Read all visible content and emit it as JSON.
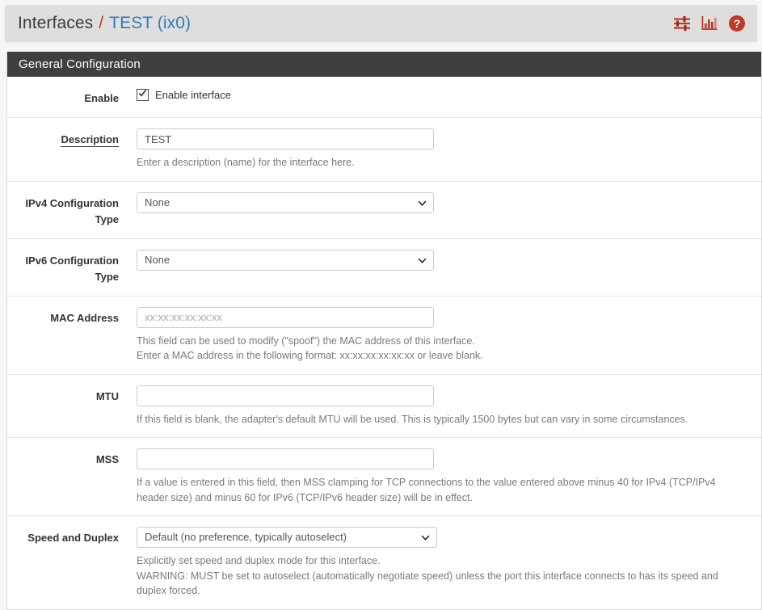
{
  "breadcrumb": {
    "root": "Interfaces",
    "separator": "/",
    "current": "TEST (ix0)"
  },
  "header_icons": [
    {
      "name": "sliders-icon",
      "title": "Advanced"
    },
    {
      "name": "bar-chart-icon",
      "title": "Status"
    },
    {
      "name": "help-icon",
      "title": "Help"
    }
  ],
  "panel": {
    "title": "General Configuration"
  },
  "fields": {
    "enable": {
      "label": "Enable",
      "checkbox_label": "Enable interface",
      "checked": true
    },
    "description": {
      "label": "Description",
      "value": "TEST",
      "help": "Enter a description (name) for the interface here."
    },
    "ipv4_config": {
      "label_line1": "IPv4 Configuration",
      "label_line2": "Type",
      "value": "None"
    },
    "ipv6_config": {
      "label_line1": "IPv6 Configuration",
      "label_line2": "Type",
      "value": "None"
    },
    "mac_address": {
      "label": "MAC Address",
      "value": "",
      "placeholder": "xx:xx:xx:xx:xx:xx",
      "help_line1": "This field can be used to modify (\"spoof\") the MAC address of this interface.",
      "help_line2": "Enter a MAC address in the following format: xx:xx:xx:xx:xx:xx or leave blank."
    },
    "mtu": {
      "label": "MTU",
      "value": "",
      "help": "If this field is blank, the adapter's default MTU will be used. This is typically 1500 bytes but can vary in some circumstances."
    },
    "mss": {
      "label": "MSS",
      "value": "",
      "help": "If a value is entered in this field, then MSS clamping for TCP connections to the value entered above minus 40 for IPv4 (TCP/IPv4 header size) and minus 60 for IPv6 (TCP/IPv6 header size) will be in effect."
    },
    "speed_duplex": {
      "label": "Speed and Duplex",
      "value": "Default (no preference, typically autoselect)",
      "help_line1": "Explicitly set speed and duplex mode for this interface.",
      "help_line2": "WARNING: MUST be set to autoselect (automatically negotiate speed) unless the port this interface connects to has its speed and duplex forced."
    }
  },
  "colors": {
    "accent_red": "#c0392b",
    "link_blue": "#337ab7",
    "panel_header": "#3f3f3f",
    "breadcrumb_bg": "#dedede"
  }
}
